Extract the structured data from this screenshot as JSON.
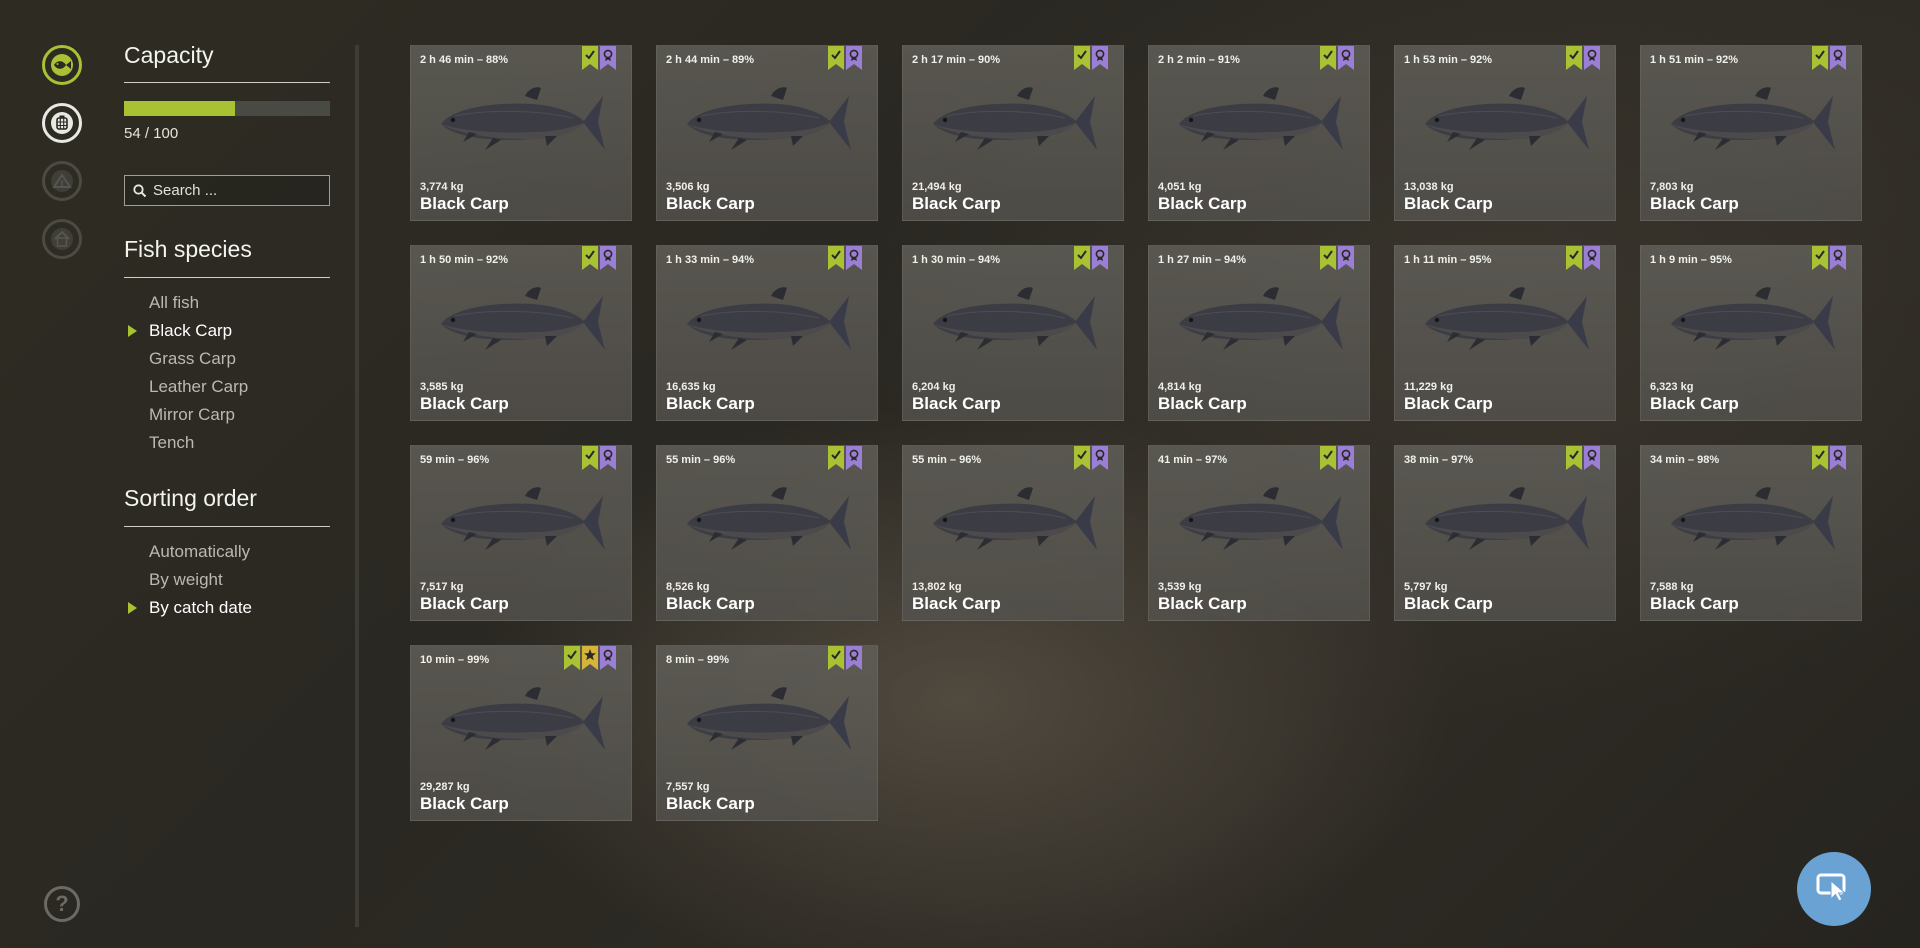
{
  "sidebar_nav": {
    "items": [
      {
        "icon": "fish-icon",
        "state": "active"
      },
      {
        "icon": "keepnet-icon",
        "state": "selected"
      },
      {
        "icon": "tent-icon",
        "state": "disabled"
      },
      {
        "icon": "house-icon",
        "state": "disabled"
      }
    ]
  },
  "capacity": {
    "title": "Capacity",
    "used": 54,
    "max": 100,
    "label": "54 / 100"
  },
  "search": {
    "placeholder": "Search ..."
  },
  "species": {
    "title": "Fish species",
    "items": [
      {
        "label": "All fish",
        "active": false
      },
      {
        "label": "Black Carp",
        "active": true
      },
      {
        "label": "Grass Carp",
        "active": false
      },
      {
        "label": "Leather Carp",
        "active": false
      },
      {
        "label": "Mirror Carp",
        "active": false
      },
      {
        "label": "Tench",
        "active": false
      }
    ]
  },
  "sorting": {
    "title": "Sorting order",
    "items": [
      {
        "label": "Automatically",
        "active": false
      },
      {
        "label": "By weight",
        "active": false
      },
      {
        "label": "By catch date",
        "active": true
      }
    ]
  },
  "colors": {
    "accent_green": "#a9c234",
    "badge_purple": "#9b7fd6",
    "badge_gold": "#d6b33a",
    "cursor_button": "#6aa2d4"
  },
  "fish": [
    {
      "time": "2 h 46 min – 88%",
      "weight": "3,774 kg",
      "name": "Black Carp",
      "badges": [
        "check",
        "ribbon"
      ]
    },
    {
      "time": "2 h 44 min – 89%",
      "weight": "3,506 kg",
      "name": "Black Carp",
      "badges": [
        "check",
        "ribbon"
      ]
    },
    {
      "time": "2 h 17 min – 90%",
      "weight": "21,494 kg",
      "name": "Black Carp",
      "badges": [
        "check",
        "ribbon"
      ]
    },
    {
      "time": "2 h 2 min – 91%",
      "weight": "4,051 kg",
      "name": "Black Carp",
      "badges": [
        "check",
        "ribbon"
      ]
    },
    {
      "time": "1 h 53 min – 92%",
      "weight": "13,038 kg",
      "name": "Black Carp",
      "badges": [
        "check",
        "ribbon"
      ]
    },
    {
      "time": "1 h 51 min – 92%",
      "weight": "7,803 kg",
      "name": "Black Carp",
      "badges": [
        "check",
        "ribbon"
      ]
    },
    {
      "time": "1 h 50 min – 92%",
      "weight": "3,585 kg",
      "name": "Black Carp",
      "badges": [
        "check",
        "ribbon"
      ]
    },
    {
      "time": "1 h 33 min – 94%",
      "weight": "16,635 kg",
      "name": "Black Carp",
      "badges": [
        "check",
        "ribbon"
      ]
    },
    {
      "time": "1 h 30 min – 94%",
      "weight": "6,204 kg",
      "name": "Black Carp",
      "badges": [
        "check",
        "ribbon"
      ]
    },
    {
      "time": "1 h 27 min – 94%",
      "weight": "4,814 kg",
      "name": "Black Carp",
      "badges": [
        "check",
        "ribbon"
      ]
    },
    {
      "time": "1 h 11 min – 95%",
      "weight": "11,229 kg",
      "name": "Black Carp",
      "badges": [
        "check",
        "ribbon"
      ]
    },
    {
      "time": "1 h 9 min – 95%",
      "weight": "6,323 kg",
      "name": "Black Carp",
      "badges": [
        "check",
        "ribbon"
      ]
    },
    {
      "time": "59 min – 96%",
      "weight": "7,517 kg",
      "name": "Black Carp",
      "badges": [
        "check",
        "ribbon"
      ]
    },
    {
      "time": "55 min – 96%",
      "weight": "8,526 kg",
      "name": "Black Carp",
      "badges": [
        "check",
        "ribbon"
      ]
    },
    {
      "time": "55 min – 96%",
      "weight": "13,802 kg",
      "name": "Black Carp",
      "badges": [
        "check",
        "ribbon"
      ]
    },
    {
      "time": "41 min – 97%",
      "weight": "3,539 kg",
      "name": "Black Carp",
      "badges": [
        "check",
        "ribbon"
      ]
    },
    {
      "time": "38 min – 97%",
      "weight": "5,797 kg",
      "name": "Black Carp",
      "badges": [
        "check",
        "ribbon"
      ]
    },
    {
      "time": "34 min – 98%",
      "weight": "7,588 kg",
      "name": "Black Carp",
      "badges": [
        "check",
        "ribbon"
      ]
    },
    {
      "time": "10 min – 99%",
      "weight": "29,287 kg",
      "name": "Black Carp",
      "badges": [
        "check",
        "star",
        "ribbon"
      ]
    },
    {
      "time": "8 min – 99%",
      "weight": "7,557 kg",
      "name": "Black Carp",
      "badges": [
        "check",
        "ribbon"
      ]
    }
  ],
  "help": {
    "icon": "question-icon",
    "label": "?"
  },
  "cursor_mode": {
    "icon": "cursor-icon"
  }
}
